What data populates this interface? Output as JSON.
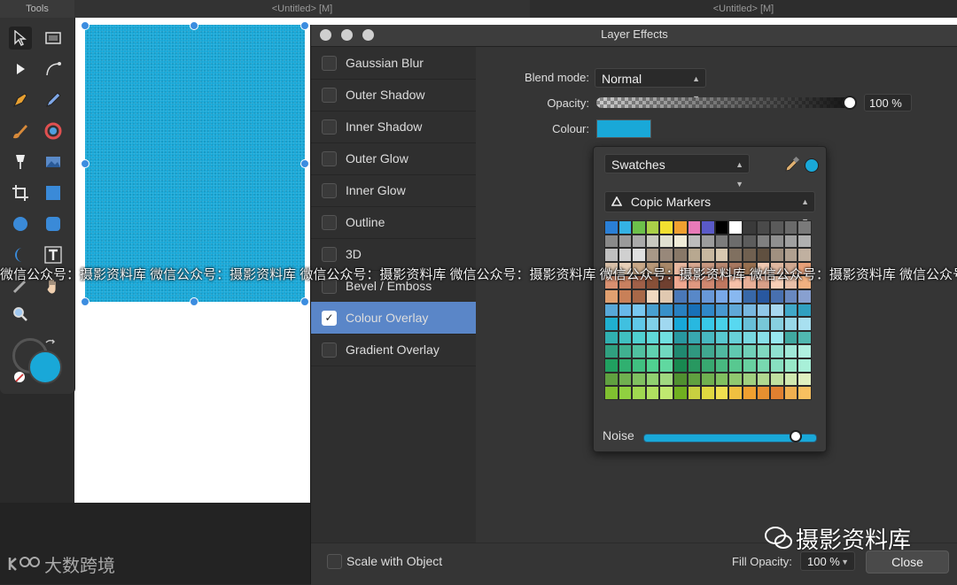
{
  "tools_panel": {
    "title": "Tools"
  },
  "document_tabs": [
    "<Untitled> [M]",
    "<Untitled> [M]"
  ],
  "dialog": {
    "title": "Layer Effects",
    "effects": [
      {
        "label": "Gaussian Blur",
        "checked": false
      },
      {
        "label": "Outer Shadow",
        "checked": false
      },
      {
        "label": "Inner Shadow",
        "checked": false
      },
      {
        "label": "Outer Glow",
        "checked": false
      },
      {
        "label": "Inner Glow",
        "checked": false
      },
      {
        "label": "Outline",
        "checked": false
      },
      {
        "label": "3D",
        "checked": false
      },
      {
        "label": "Bevel / Emboss",
        "checked": false
      },
      {
        "label": "Colour Overlay",
        "checked": true
      },
      {
        "label": "Gradient Overlay",
        "checked": false
      }
    ],
    "checkmark": "✓",
    "blend_mode_label": "Blend mode:",
    "blend_mode_value": "Normal",
    "opacity_label": "Opacity:",
    "opacity_value": "100 %",
    "colour_label": "Colour:",
    "colour_value": "#19a8d8",
    "popover": {
      "mode_value": "Swatches",
      "palette_value": "Copic Markers",
      "noise_label": "Noise",
      "noise_level": 0.87
    },
    "footer": {
      "scale_label": "Scale with Object",
      "fill_opacity_label": "Fill Opacity:",
      "fill_opacity_value": "100 %",
      "close_label": "Close"
    }
  },
  "swatches": [
    "#2a7fd6",
    "#34b2e4",
    "#6cc04a",
    "#aad048",
    "#f2e030",
    "#f0a030",
    "#e87ab8",
    "#5a5ac8",
    "#000000",
    "#ffffff",
    "#3a3a3a",
    "#4a4a4a",
    "#5a5a5a",
    "#6a6a6a",
    "#7a7a7a",
    "#8a8a8a",
    "#9a9a9a",
    "#aaaaaa",
    "#c8c8c0",
    "#e0e0d0",
    "#f0ecd8",
    "#bcbcbc",
    "#9c9c9c",
    "#7c7c7c",
    "#6c6c6c",
    "#5c5c5c",
    "#808080",
    "#909090",
    "#a0a0a0",
    "#b0b0b0",
    "#c0c0c0",
    "#d0d0d0",
    "#e0e0e0",
    "#a89888",
    "#98887a",
    "#887868",
    "#b8a890",
    "#c8b8a0",
    "#d8c8b0",
    "#807060",
    "#706050",
    "#605040",
    "#a09080",
    "#b0a090",
    "#c0b0a0",
    "#d8c0a8",
    "#e8d0b8",
    "#c8a888",
    "#b89878",
    "#a88868",
    "#e8b8a0",
    "#d8a890",
    "#c89880",
    "#b88870",
    "#a87860",
    "#987050",
    "#f0c8b0",
    "#e0b8a0",
    "#d0a890",
    "#e8a078",
    "#d89070",
    "#c88060",
    "#a06048",
    "#885038",
    "#704030",
    "#f0a890",
    "#e09880",
    "#d08870",
    "#c07860",
    "#f8c0a8",
    "#e8b098",
    "#d8a088",
    "#f8d0b8",
    "#e8c0a8",
    "#f0b080",
    "#e0a070",
    "#c88058",
    "#a86848",
    "#f0d8c0",
    "#e0c8b0",
    "#4a78b8",
    "#5888c8",
    "#6898d8",
    "#78a8e8",
    "#88b8f0",
    "#3868a8",
    "#2858a0",
    "#4870b0",
    "#6888c0",
    "#88a0d0",
    "#58a8d8",
    "#68b8e8",
    "#78c8f0",
    "#48a0d0",
    "#3890c8",
    "#2880c0",
    "#1870b8",
    "#3088c8",
    "#4898d0",
    "#60a8d8",
    "#78b8e0",
    "#90c8e8",
    "#a8d8f0",
    "#40a8c8",
    "#30a0c0",
    "#20b0d0",
    "#40c0e0",
    "#60c8e8",
    "#80d0e8",
    "#a0d8f0",
    "#18a8d8",
    "#28b8e0",
    "#38c8e8",
    "#48d0e8",
    "#58d8f0",
    "#68c0d8",
    "#78c8d8",
    "#88d0e0",
    "#98d8e8",
    "#a8e0f0",
    "#30b0b0",
    "#40c0c0",
    "#50d0d0",
    "#60d8d8",
    "#70e0e0",
    "#2898a0",
    "#38a8b0",
    "#48b8c0",
    "#58c8d0",
    "#68d0d8",
    "#78d8e0",
    "#88e0e8",
    "#98e8f0",
    "#40a8a0",
    "#50b8b0",
    "#30a080",
    "#40b090",
    "#50c0a0",
    "#60d0b0",
    "#70d8c0",
    "#208870",
    "#309880",
    "#40a890",
    "#50b8a0",
    "#60c8b0",
    "#70d0b8",
    "#80d8c0",
    "#90e0d0",
    "#a0e8d8",
    "#b0f0e0",
    "#20a060",
    "#30b070",
    "#40c080",
    "#50d090",
    "#60d8a0",
    "#188850",
    "#289860",
    "#38a870",
    "#48b880",
    "#58c890",
    "#68d0a0",
    "#78d8b0",
    "#88e0c0",
    "#98e8c8",
    "#a8f0d8",
    "#60a040",
    "#70b050",
    "#80c060",
    "#90d070",
    "#a0d880",
    "#509030",
    "#60a040",
    "#70b050",
    "#80c060",
    "#90c870",
    "#a0d080",
    "#b0d890",
    "#c0e0a0",
    "#d0e8b0",
    "#e0f0c0",
    "#80c030",
    "#90d040",
    "#a0d850",
    "#b0e060",
    "#c0e870",
    "#70b020",
    "#c8d040",
    "#e0d840",
    "#f0e050",
    "#f0c040",
    "#f0a030",
    "#e89030",
    "#e08030",
    "#f0b050",
    "#f8c060"
  ],
  "watermarks": {
    "strip": "微信公众号：摄影资料库  微信公众号：摄影资料库  微信公众号：摄影资料库  微信公众号：摄影资料库  微信公众号：摄影资料库  微信公众号：摄影资料库  微信公众号：摄影",
    "bottom_right": "摄影资料库",
    "bottom_left": "大数跨境"
  }
}
